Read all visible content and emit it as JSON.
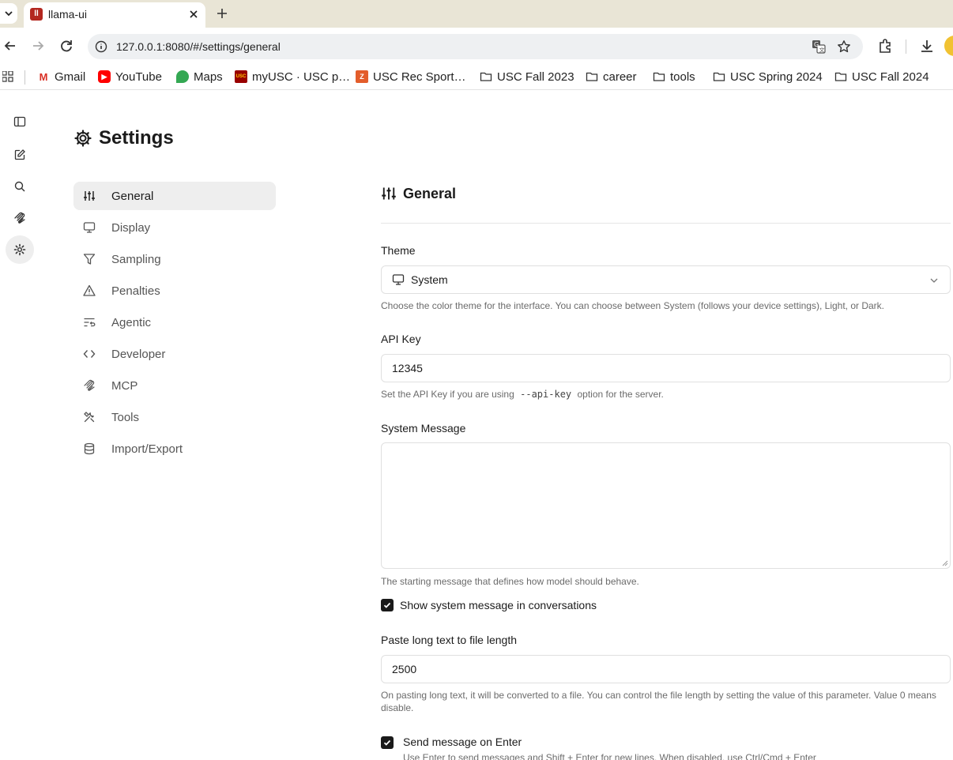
{
  "browser": {
    "tab_title": "llama-ui",
    "url": "127.0.0.1:8080/#/settings/general",
    "bookmarks": [
      {
        "label": "Gmail",
        "icon": "gmail-icon"
      },
      {
        "label": "YouTube",
        "icon": "youtube-icon"
      },
      {
        "label": "Maps",
        "icon": "maps-icon"
      },
      {
        "label": "myUSC · USC p…",
        "icon": "usc-icon"
      },
      {
        "label": "USC Rec Sport…",
        "icon": "usc-rec-icon"
      },
      {
        "label": "USC Fall 2023",
        "icon": "folder-icon"
      },
      {
        "label": "career",
        "icon": "folder-icon"
      },
      {
        "label": "tools",
        "icon": "folder-icon"
      },
      {
        "label": "USC Spring 2024",
        "icon": "folder-icon"
      },
      {
        "label": "USC Fall 2024",
        "icon": "folder-icon"
      }
    ]
  },
  "settings": {
    "title": "Settings",
    "nav": [
      {
        "label": "General",
        "icon": "sliders-icon",
        "active": true
      },
      {
        "label": "Display",
        "icon": "monitor-icon"
      },
      {
        "label": "Sampling",
        "icon": "funnel-icon"
      },
      {
        "label": "Penalties",
        "icon": "warning-icon"
      },
      {
        "label": "Agentic",
        "icon": "list-loop-icon"
      },
      {
        "label": "Developer",
        "icon": "code-icon"
      },
      {
        "label": "MCP",
        "icon": "mcp-icon"
      },
      {
        "label": "Tools",
        "icon": "tools-icon"
      },
      {
        "label": "Import/Export",
        "icon": "database-icon"
      }
    ],
    "section_title": "General",
    "theme": {
      "label": "Theme",
      "value": "System",
      "help": "Choose the color theme for the interface. You can choose between System (follows your device settings), Light, or Dark."
    },
    "api_key": {
      "label": "API Key",
      "value": "12345",
      "help_before": "Set the API Key if you are using",
      "help_code": "--api-key",
      "help_after": "option for the server."
    },
    "system_message": {
      "label": "System Message",
      "value": "",
      "help": "The starting message that defines how model should behave."
    },
    "show_system_message": {
      "label": "Show system message in conversations",
      "checked": true
    },
    "paste_length": {
      "label": "Paste long text to file length",
      "value": "2500",
      "help": "On pasting long text, it will be converted to a file. You can control the file length by setting the value of this parameter. Value 0 means disable."
    },
    "send_on_enter": {
      "label": "Send message on Enter",
      "checked": true,
      "help": "Use Enter to send messages and Shift + Enter for new lines. When disabled, use Ctrl/Cmd + Enter"
    }
  }
}
